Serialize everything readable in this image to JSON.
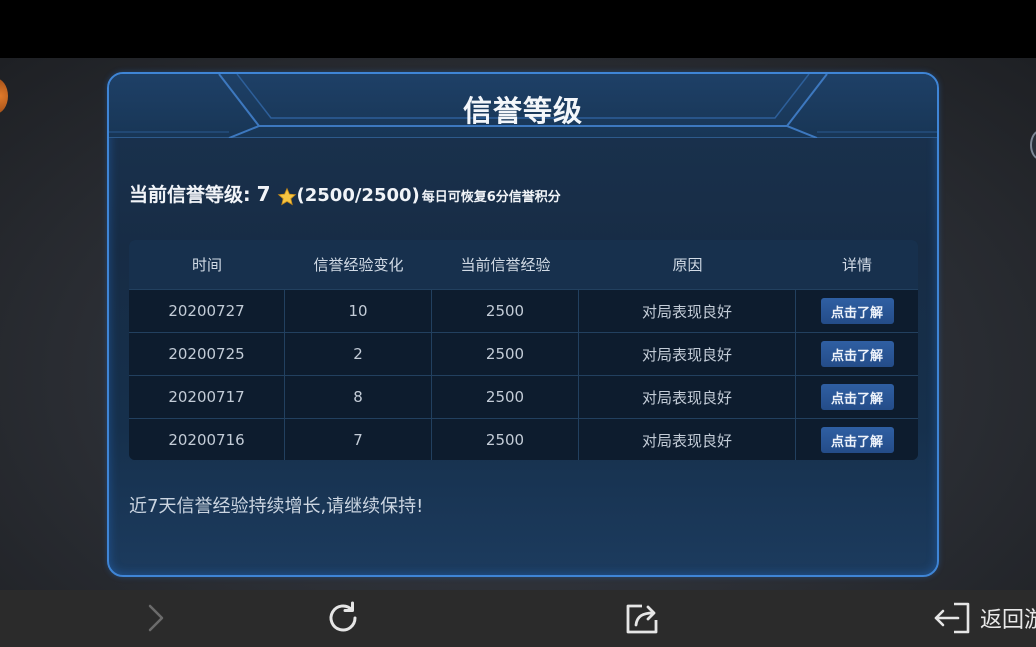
{
  "panel": {
    "title": "信誉等级"
  },
  "credit_level": {
    "label": "当前信誉等级:",
    "value": "7",
    "star_icon": "star-icon",
    "progress": "(2500/2500)",
    "note": "每日可恢复6分信誉积分"
  },
  "table": {
    "headers": [
      "时间",
      "信誉经验变化",
      "当前信誉经验",
      "原因",
      "详情"
    ],
    "rows": [
      {
        "date": "20200727",
        "change": "10",
        "current": "2500",
        "reason": "对局表现良好",
        "detail": "点击了解"
      },
      {
        "date": "20200725",
        "change": "2",
        "current": "2500",
        "reason": "对局表现良好",
        "detail": "点击了解"
      },
      {
        "date": "20200717",
        "change": "8",
        "current": "2500",
        "reason": "对局表现良好",
        "detail": "点击了解"
      },
      {
        "date": "20200716",
        "change": "7",
        "current": "2500",
        "reason": "对局表现良好",
        "detail": "点击了解"
      }
    ]
  },
  "footer": {
    "message": "近7天信誉经验持续增长,请继续保持!"
  },
  "bottom_nav": {
    "forward_icon": "chevron-right-icon",
    "refresh_icon": "refresh-icon",
    "share_icon": "share-icon",
    "back_icon": "exit-icon",
    "back_label": "返回游"
  },
  "colors": {
    "panel_border": "#3f85d6",
    "panel_bg": "#172c45",
    "button_bg": "#2f5fa3",
    "star": "#f5c542"
  }
}
